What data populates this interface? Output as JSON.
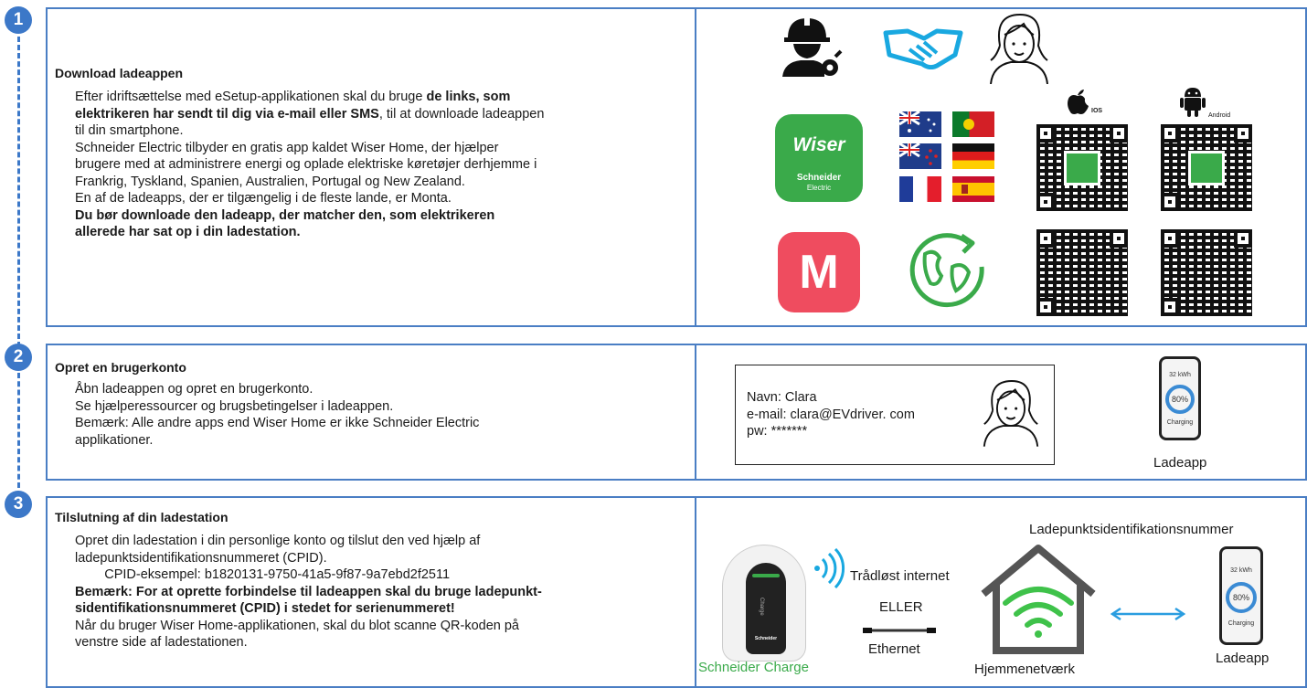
{
  "steps": [
    {
      "number": "1",
      "title": "Download ladeappen",
      "lines": [
        {
          "parts": [
            {
              "text": "Efter idriftsættelse med eSetup-applikationen skal du bruge ",
              "bold": false
            },
            {
              "text": "de links, som",
              "bold": true
            }
          ]
        },
        {
          "parts": [
            {
              "text": "elektrikeren har sendt til dig via e-mail eller SMS",
              "bold": true
            },
            {
              "text": ", til at downloade ladeappen",
              "bold": false
            }
          ]
        },
        {
          "parts": [
            {
              "text": "til din smartphone.",
              "bold": false
            }
          ]
        },
        {
          "parts": [
            {
              "text": "Schneider Electric tilbyder en gratis app kaldet Wiser Home, der hjælper",
              "bold": false
            }
          ]
        },
        {
          "parts": [
            {
              "text": "brugere med at administrere energi og oplade elektriske køretøjer derhjemme i",
              "bold": false
            }
          ]
        },
        {
          "parts": [
            {
              "text": "Frankrig, Tyskland, Spanien, Australien, Portugal og New Zealand.",
              "bold": false
            }
          ]
        },
        {
          "parts": [
            {
              "text": "En af de ladeapps, der er tilgængelig i de fleste lande, er Monta.",
              "bold": false
            }
          ]
        },
        {
          "parts": [
            {
              "text": "Du bør downloade den ladeapp, der matcher den, som elektrikeren",
              "bold": true
            }
          ]
        },
        {
          "parts": [
            {
              "text": "allerede har sat op i din ladestation.",
              "bold": true
            }
          ]
        }
      ]
    },
    {
      "number": "2",
      "title": "Opret en brugerkonto",
      "lines": [
        {
          "parts": [
            {
              "text": "Åbn ladeappen og opret en brugerkonto.",
              "bold": false
            }
          ]
        },
        {
          "parts": [
            {
              "text": "Se hjælperessourcer og brugsbetingelser i ladeappen.",
              "bold": false
            }
          ]
        },
        {
          "parts": [
            {
              "text": "Bemærk: Alle andre apps end Wiser Home er ikke Schneider Electric",
              "bold": false
            }
          ]
        },
        {
          "parts": [
            {
              "text": "applikationer.",
              "bold": false
            }
          ]
        }
      ]
    },
    {
      "number": "3",
      "title": "Tilslutning af din ladestation",
      "lines": [
        {
          "parts": [
            {
              "text": "Opret din ladestation i din personlige konto og tilslut den ved hjælp af",
              "bold": false
            }
          ]
        },
        {
          "parts": [
            {
              "text": "ladepunktsidentifikationsnummeret (CPID).",
              "bold": false
            }
          ]
        },
        {
          "parts": [
            {
              "text": "        CPID-eksempel: b1820131-9750-41a5-9f87-9a7ebd2f2511",
              "bold": false
            }
          ]
        },
        {
          "parts": [
            {
              "text": "Bemærk: For at oprette forbindelse til ladeappen skal du bruge ladepunkt-",
              "bold": true
            }
          ]
        },
        {
          "parts": [
            {
              "text": "sidentifikationsnummeret (CPID) i stedet for serienummeret!",
              "bold": true
            }
          ]
        },
        {
          "parts": [
            {
              "text": "Når du bruger Wiser Home-applikationen, skal du blot scanne QR-koden på",
              "bold": false
            }
          ]
        },
        {
          "parts": [
            {
              "text": "venstre side af ladestationen.",
              "bold": false
            }
          ]
        }
      ]
    }
  ],
  "apps": {
    "wiser_logo_text": "Wiser",
    "schneider_logo_line1": "Schneider",
    "schneider_logo_line2": "Electric",
    "monta_letter": "M",
    "ios_label": "IOS",
    "android_label": "Android"
  },
  "account_card": {
    "name_line": "Navn: Clara",
    "email_line": "e-mail: clara@EVdriver. com",
    "pw_line": "pw: *******"
  },
  "phone": {
    "energy": "32 kWh",
    "percent": "80%",
    "status": "Charging",
    "charge_fraction": 0.8
  },
  "labels": {
    "ladeapp_step2": "Ladeapp",
    "ladeapp_step3": "Ladeapp",
    "cpid_heading": "Ladepunktsidentifikationsnummer",
    "wireless": "Trådløst internet",
    "or": "ELLER",
    "ethernet": "Ethernet",
    "home_network": "Hjemmenetværk",
    "charger_name": "Schneider Charge",
    "charger_side_text": "Charge",
    "charger_brand": "Schneider"
  },
  "colors": {
    "accent_blue": "#3c78c8",
    "panel_border": "#4a7ec4",
    "wiser_green": "#3aaa4a",
    "monta_red": "#ef4c5f",
    "wifi_green": "#3fc24a",
    "arrow_blue": "#2a9de0",
    "charger_green": "#3aaa4a"
  },
  "icons": [
    "installer-icon",
    "handshake-icon",
    "user-woman-icon",
    "apple-icon",
    "android-icon",
    "globe-icon",
    "wifi-signal-icon",
    "house-icon",
    "double-arrow-icon",
    "ethernet-cable-icon"
  ]
}
